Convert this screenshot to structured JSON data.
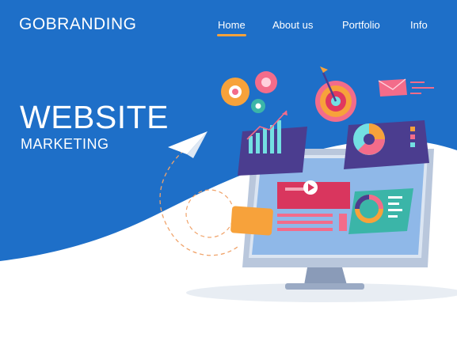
{
  "brand": {
    "name": "GOBRANDING"
  },
  "nav": {
    "items": [
      {
        "label": "Home",
        "active": true
      },
      {
        "label": "About us"
      },
      {
        "label": "Portfolio"
      },
      {
        "label": "Info"
      }
    ]
  },
  "hero": {
    "title": "WEBSITE",
    "subtitle": "MARKETING"
  },
  "colors": {
    "brand_blue": "#1e6fc8",
    "accent_orange": "#f7a23b",
    "purple": "#4b3d8f",
    "teal": "#3bb5a8",
    "pink": "#f36c8a"
  },
  "icons": [
    "paper-plane-icon",
    "gear-icon",
    "target-icon",
    "envelope-icon",
    "bar-chart-icon",
    "pie-chart-icon",
    "monitor-icon"
  ]
}
